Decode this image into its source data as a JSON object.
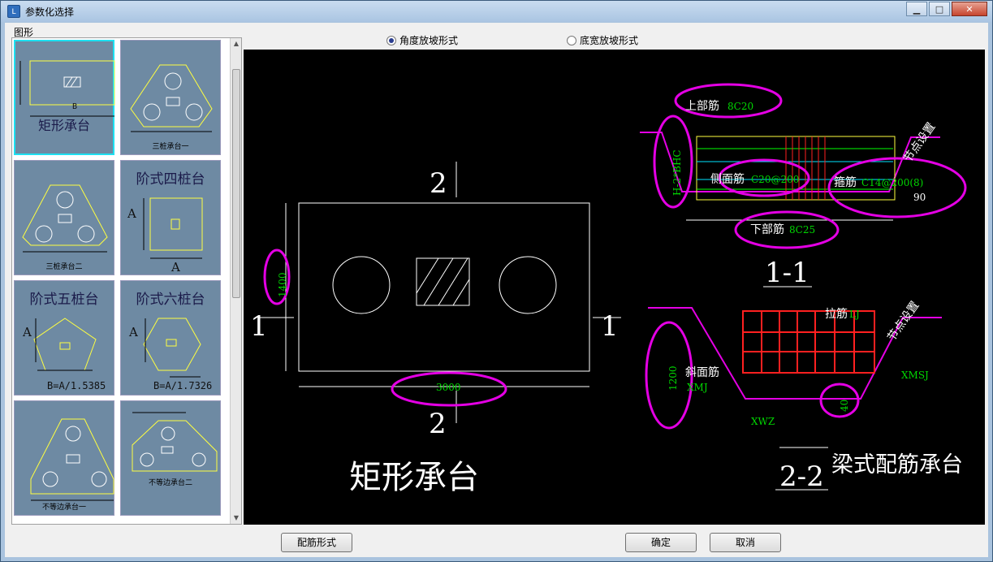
{
  "window": {
    "title": "参数化选择",
    "app_icon": "app-icon",
    "controls": [
      "minimize-icon",
      "maximize-icon",
      "close-icon"
    ]
  },
  "left_panel": {
    "label": "图形",
    "thumbnails": [
      {
        "label": "矩形承台",
        "dim": "B",
        "selected": true
      },
      {
        "label": "三桩承台一"
      },
      {
        "label": "三桩承台二"
      },
      {
        "title": "阶式四桩台",
        "dim_a": "A",
        "dim_b": "A"
      },
      {
        "title": "阶式五桩台",
        "dim_a": "A",
        "formula": "B=A/1.5385"
      },
      {
        "title": "阶式六桩台",
        "dim_a": "A",
        "formula": "B=A/1.7326"
      },
      {
        "label": "不等边承台一"
      },
      {
        "label": "不等边承台二"
      }
    ]
  },
  "options": {
    "radio1": "角度放坡形式",
    "radio2": "底宽放坡形式",
    "selected": "radio1"
  },
  "drawing": {
    "main_title": "矩形承台",
    "section_2_top": "2",
    "section_2_bottom": "2",
    "section_1_left": "1",
    "section_1_right": "1",
    "dim_height": "1400",
    "dim_width": "3000",
    "sec11": {
      "title": "1-1",
      "top_bar_label": "上部筋",
      "top_bar_value": "8C20",
      "side_bar_label": "侧面筋",
      "side_bar_value": "C20@200",
      "stirrup_label": "箍筋",
      "stirrup_value": "C14@200(8)",
      "bottom_bar_label": "下部筋",
      "bottom_bar_value": "8C25",
      "height_formula": "H-2*BHC",
      "node_setting": "节点设置",
      "angle": "90"
    },
    "sec22": {
      "title": "2-2",
      "tie_label": "拉筋",
      "tie_value": "LJ",
      "slope_label": "斜面筋",
      "slope_value": "XMJ",
      "height": "1200",
      "xwz": "XWZ",
      "xmsj": "XMSJ",
      "cover": "40",
      "node_setting": "节点设置"
    },
    "beam_title": "梁式配筋承台",
    "colors": {
      "highlight": "#e400e4",
      "dim_green": "#00d800",
      "rebar_red": "#ff2020",
      "outline_yellow": "#ffff40"
    }
  },
  "buttons": {
    "rebar_form": "配筋形式",
    "ok": "确定",
    "cancel": "取消"
  }
}
